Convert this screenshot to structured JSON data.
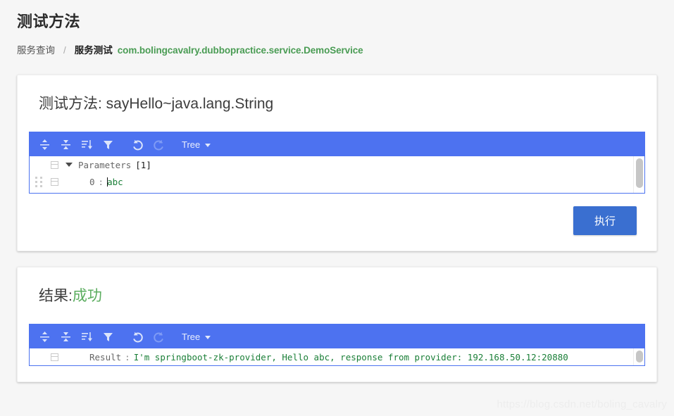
{
  "page": {
    "title": "测试方法",
    "watermark": "https://blog.csdn.net/boling_cavalry"
  },
  "breadcrumb": {
    "first": "服务查询",
    "separator": "/",
    "second": "服务测试",
    "service": "com.bolingcavalry.dubbopractice.service.DemoService"
  },
  "test_card": {
    "heading_prefix": "测试方法: ",
    "method": "sayHello~java.lang.String",
    "editor": {
      "toolbar": {
        "expand_all": "expand-all-icon",
        "collapse_all": "collapse-all-icon",
        "sort": "sort-icon",
        "filter": "filter-icon",
        "undo": "undo-icon",
        "redo": "redo-icon",
        "mode_label": "Tree"
      },
      "rows": [
        {
          "field": "Parameters",
          "count": "[1]"
        },
        {
          "index": "0",
          "colon": ":",
          "value": "abc"
        }
      ]
    },
    "execute_label": "执行"
  },
  "result_card": {
    "heading_prefix": "结果:",
    "status": "成功",
    "editor": {
      "toolbar": {
        "expand_all": "expand-all-icon",
        "collapse_all": "collapse-all-icon",
        "sort": "sort-icon",
        "filter": "filter-icon",
        "undo": "undo-icon",
        "redo": "redo-icon",
        "mode_label": "Tree"
      },
      "row": {
        "field": "Result",
        "colon": ":",
        "value": "I'm springboot-zk-provider, Hello abc, response from provider: 192.168.50.12:20880"
      }
    }
  },
  "colors": {
    "toolbar_blue": "#4d72f0",
    "button_blue": "#3a6fd0",
    "accent_green": "#4a9c54",
    "value_green": "#1a7f37",
    "page_background": "#f6f6f6"
  }
}
